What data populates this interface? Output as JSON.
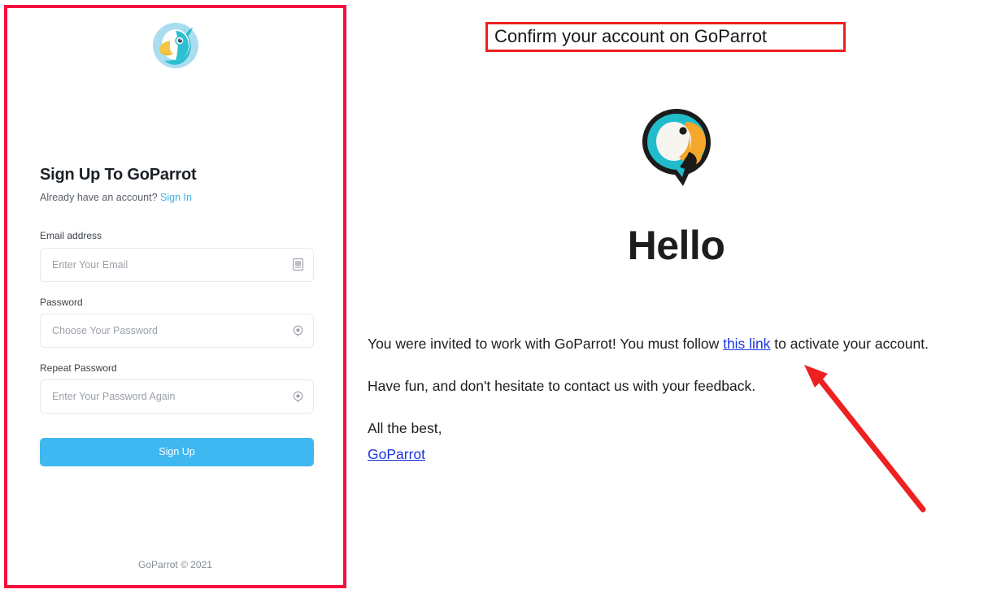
{
  "signup_panel": {
    "logo_icon": "goparrot-parrot-logo",
    "title": "Sign Up To GoParrot",
    "have_account_text": "Already have an account?",
    "signin_link": "Sign In",
    "fields": [
      {
        "label": "Email address",
        "placeholder": "Enter Your Email",
        "value": "",
        "icon": "envelope-icon",
        "name": "email"
      },
      {
        "label": "Password",
        "placeholder": "Choose Your Password",
        "value": "",
        "icon": "eye-icon",
        "name": "password"
      },
      {
        "label": "Repeat Password",
        "placeholder": "Enter Your Password Again",
        "value": "",
        "icon": "eye-icon",
        "name": "repeat-password"
      }
    ],
    "submit_label": "Sign Up",
    "footer": "GoParrot © 2021",
    "accent_color": "#3fb8f2",
    "link_color": "#3fb0e8",
    "annotation_border_color": "#f50f3f"
  },
  "email_panel": {
    "subject": "Confirm your account on GoParrot",
    "subject_box_color": "#ee2020",
    "logo_icon": "goparrot-parrot-logo-color",
    "heading": "Hello",
    "paragraph1_before": "You were invited to work with GoParrot! You must follow ",
    "paragraph1_link": "this link",
    "paragraph1_after": " to activate your account.",
    "paragraph2": "Have fun, and don't hesitate to contact us with your feedback.",
    "paragraph3": "All the best,",
    "signature_link": "GoParrot",
    "link_color": "#1a36e0"
  },
  "annotations": {
    "arrow_color": "#ee2020",
    "arrow_target": "this link"
  }
}
